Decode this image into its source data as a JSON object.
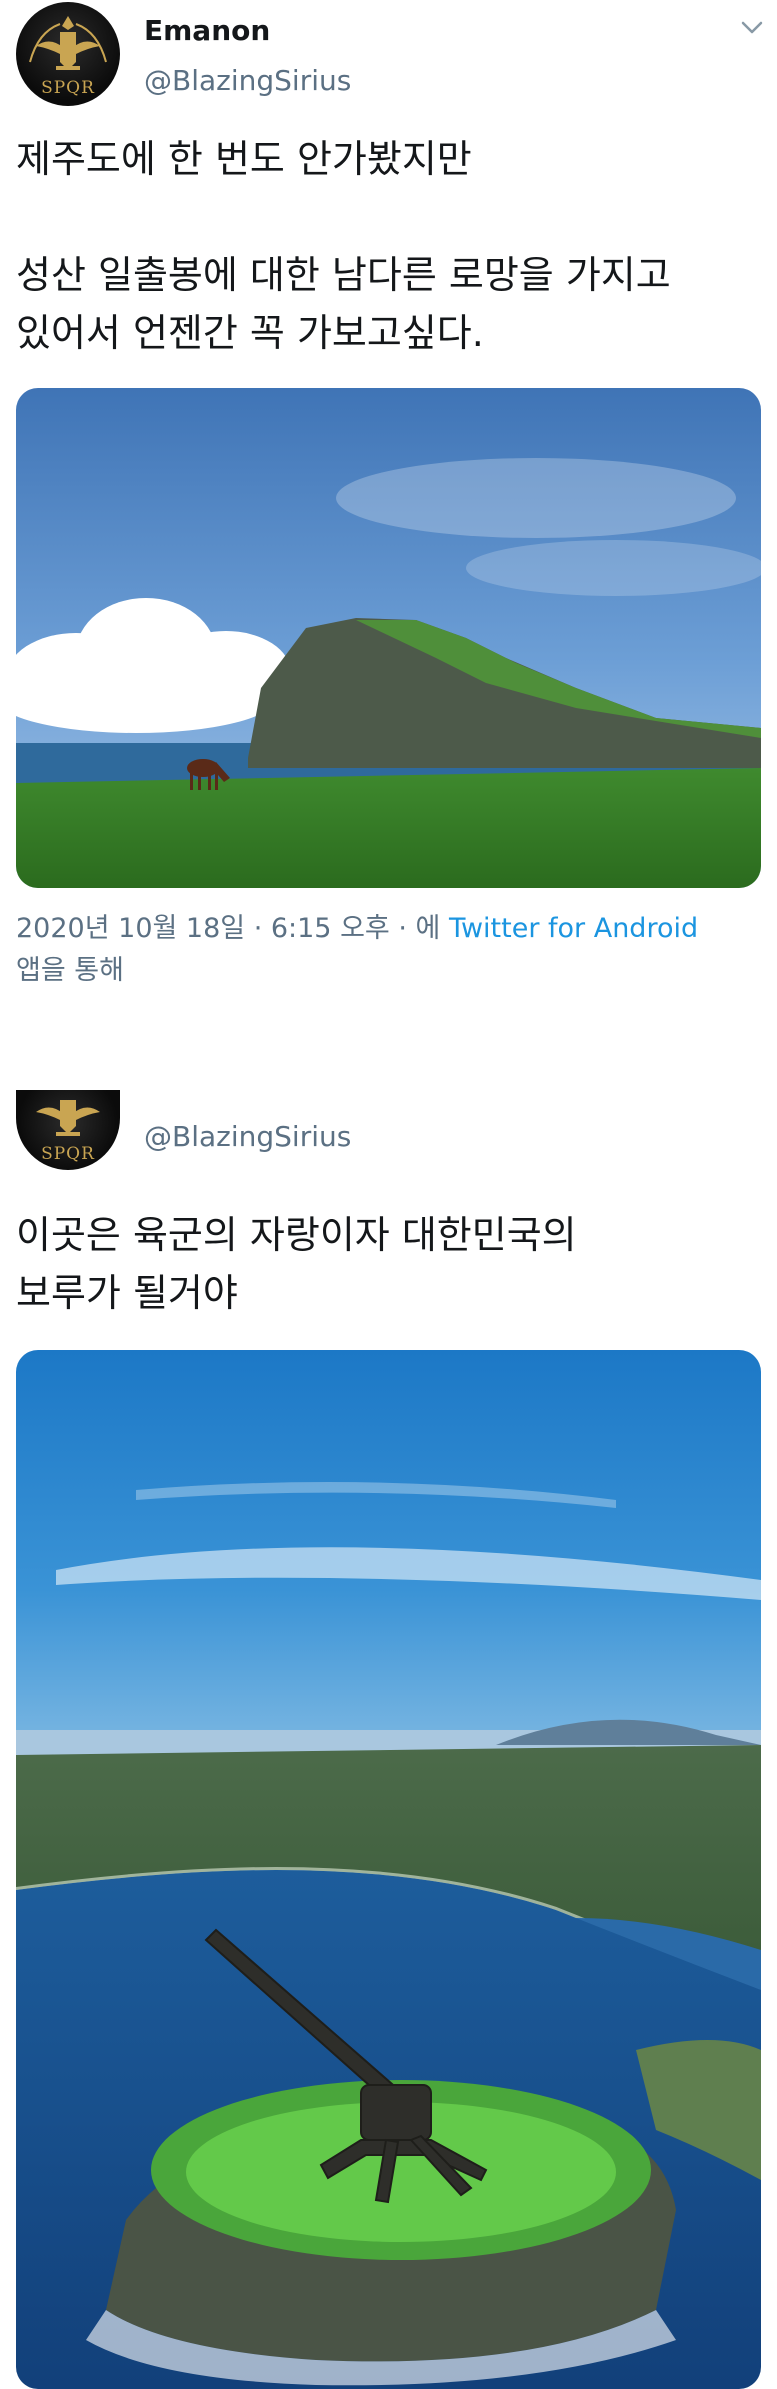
{
  "tweet1": {
    "display_name": "Emanon",
    "handle": "@BlazingSirius",
    "avatar_text": "SPQR",
    "text": "제주도에 한 번도 안가봤지만\n\n성산 일출봉에 대한 남다른 로망을 가지고\n있어서 언젠간 꼭 가보고싶다.",
    "timestamp": "2020년 10월 18일 · 6:15 오후 · 에",
    "source": "Twitter for Android",
    "source_suffix": "앱을 통해"
  },
  "tweet2": {
    "handle": "@BlazingSirius",
    "avatar_text": "SPQR",
    "text": "이곳은 육군의 자랑이자 대한민국의\n보루가 될거야"
  },
  "icons": {
    "avatar": "spqr-eagle-icon",
    "menu": "chevron-down-icon"
  },
  "colors": {
    "text": "#14171a",
    "secondary": "#5b7083",
    "link": "#1b95e0"
  }
}
